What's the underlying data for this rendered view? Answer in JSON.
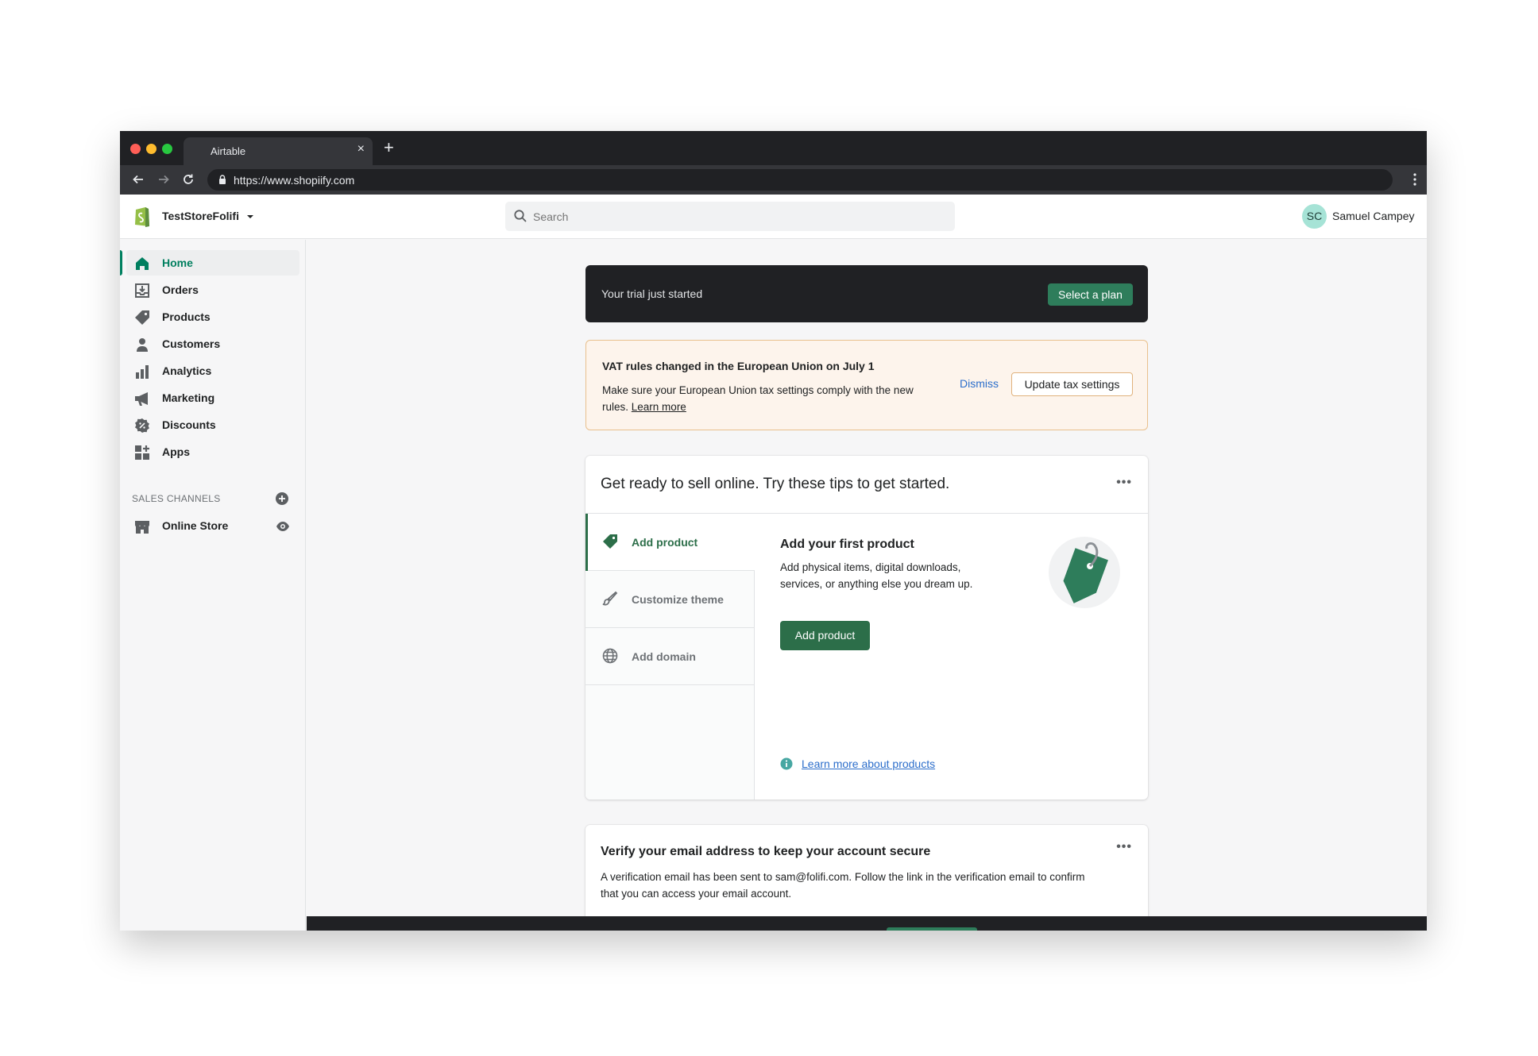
{
  "browser": {
    "tab_title": "Airtable",
    "tab_close": "×",
    "new_tab": "+",
    "url": "https://www.shopiify.com",
    "icons": {
      "back": "arrow-left-icon",
      "forward": "arrow-right-icon",
      "reload": "reload-icon",
      "lock": "lock-icon",
      "menu": "kebab-menu-icon"
    }
  },
  "topbar": {
    "store_name": "TestStoreFolifi",
    "search_placeholder": "Search",
    "avatar_initials": "SC",
    "user_name": "Samuel Campey"
  },
  "sidebar": {
    "items": [
      {
        "label": "Home",
        "icon": "home-icon",
        "active": true
      },
      {
        "label": "Orders",
        "icon": "orders-icon"
      },
      {
        "label": "Products",
        "icon": "tag-icon"
      },
      {
        "label": "Customers",
        "icon": "person-icon"
      },
      {
        "label": "Analytics",
        "icon": "bar-chart-icon"
      },
      {
        "label": "Marketing",
        "icon": "megaphone-icon"
      },
      {
        "label": "Discounts",
        "icon": "discount-icon"
      },
      {
        "label": "Apps",
        "icon": "apps-icon"
      }
    ],
    "sales_channels_title": "SALES CHANNELS",
    "channels": [
      {
        "label": "Online Store",
        "icon": "store-icon"
      }
    ]
  },
  "trial": {
    "text": "Your trial just started",
    "button": "Select a plan"
  },
  "vat": {
    "title": "VAT rules changed in the European Union on July 1",
    "body": "Make sure your European Union tax settings comply with the new rules.",
    "link": "Learn more",
    "dismiss": "Dismiss",
    "button": "Update tax settings"
  },
  "setup_card": {
    "title": "Get ready to sell online. Try these tips to get started.",
    "menu": "•••",
    "tips": [
      {
        "label": "Add product",
        "icon": "tag-icon",
        "active": true
      },
      {
        "label": "Customize theme",
        "icon": "brush-icon"
      },
      {
        "label": "Add domain",
        "icon": "globe-icon"
      }
    ],
    "detail_title": "Add your first product",
    "detail_desc": "Add physical items, digital downloads, services, or anything else you dream up.",
    "detail_button": "Add product",
    "learn_link": "Learn more about products"
  },
  "verify_card": {
    "title": "Verify your email address to keep your account secure",
    "menu": "•••",
    "body": "A verification email has been sent to sam@folifi.com. Follow the link in the verification email to confirm that you can access your email account."
  },
  "colors": {
    "accent": "#2c6e49",
    "dark": "#202124",
    "banner_bg": "#fdf4ec",
    "link": "#2c6ecb"
  }
}
